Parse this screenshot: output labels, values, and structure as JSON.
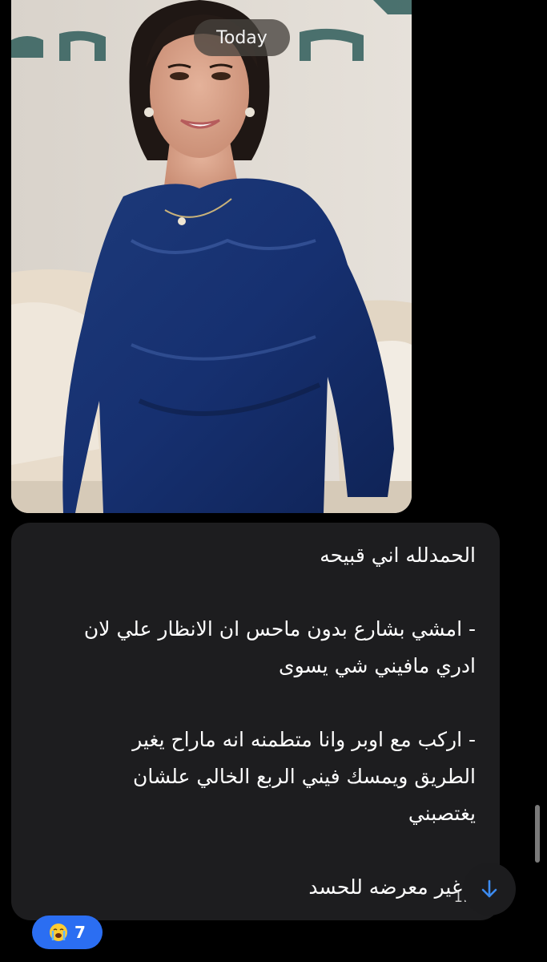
{
  "header": {
    "date_label": "Today"
  },
  "message": {
    "lines": [
      "الحمدلله اني قبيحه",
      "",
      "- امشي بشارع بدون ماحس ان الانظار علي لان",
      "ادري مافيني شي يسوى",
      "",
      "- اركب مع اوبر وانا متطمنه انه ماراح يغير",
      "الطريق ويمسك فيني الربع الخالي علشان",
      "يغتصبني",
      "",
      "- غير معرضه للحسد"
    ],
    "timestamp_partial": "1:"
  },
  "reaction": {
    "emoji_icon": "loudly-crying-face-icon",
    "count": "7"
  },
  "scroll_down": {
    "icon": "arrow-down-icon"
  },
  "colors": {
    "background": "#000000",
    "bubble": "#1d1d1f",
    "accent": "#3c8bf0",
    "reaction_pill": "#2b6ef2"
  }
}
